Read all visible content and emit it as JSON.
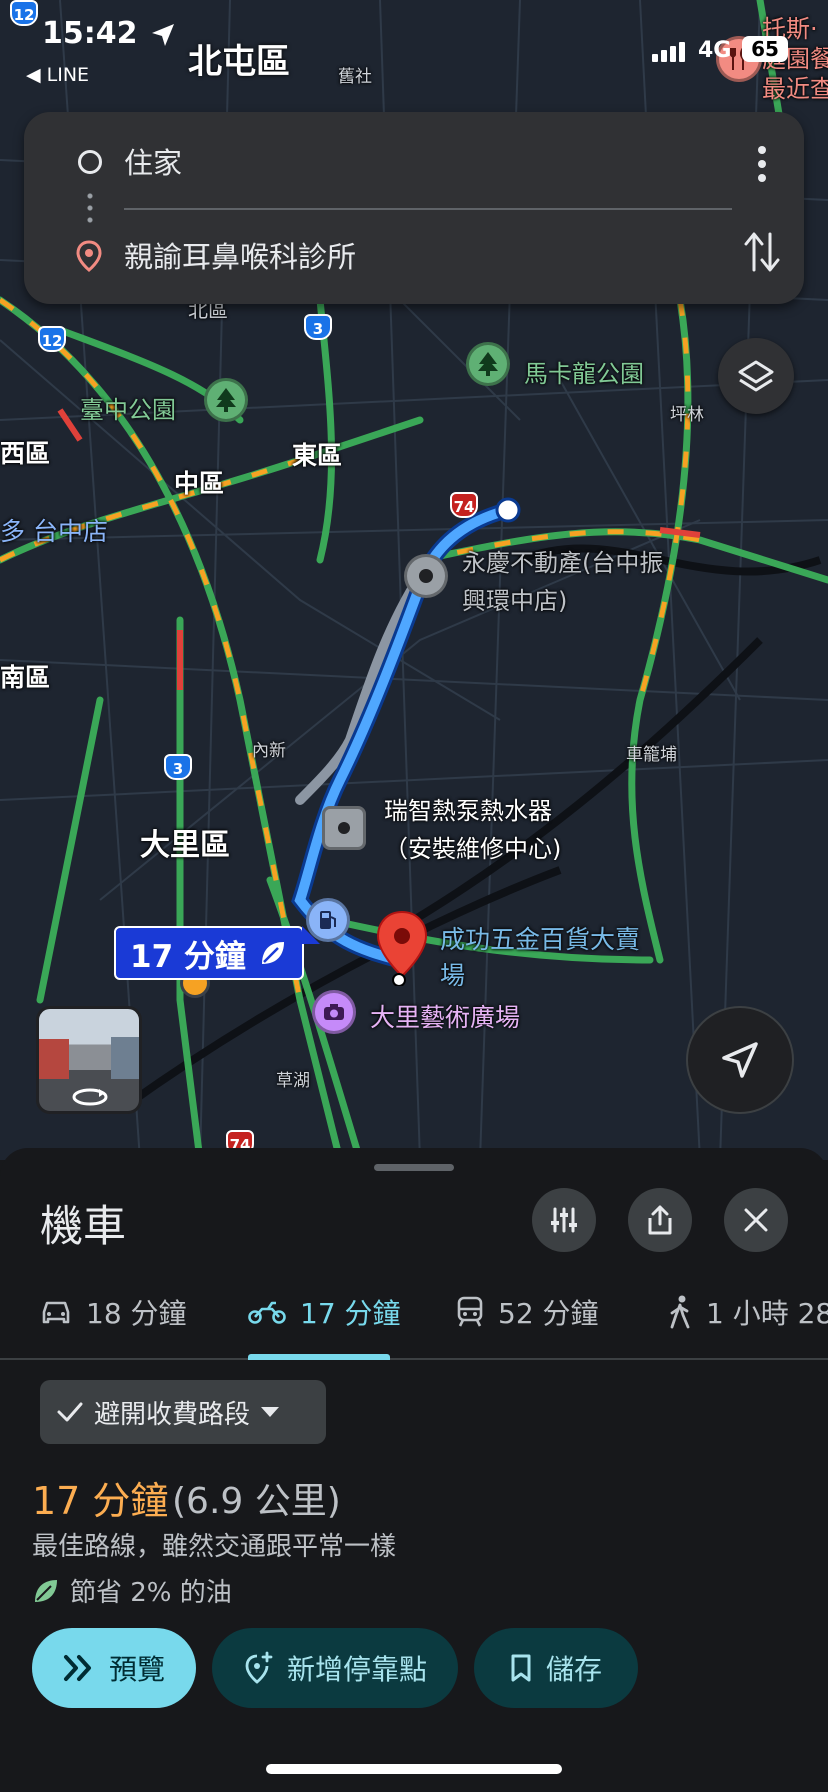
{
  "status_bar": {
    "time": "15:42",
    "back_app": "◀ LINE",
    "district": "北屯區",
    "network": "4G",
    "battery": "65"
  },
  "route_card": {
    "origin": "住家",
    "destination": "親諭耳鼻喉科診所"
  },
  "map": {
    "labels": {
      "beitun_small": "北屯",
      "jiushe": "舊社",
      "makalong_park": "馬卡龍公園",
      "pinglin": "坪林",
      "taichung_park": "臺中公園",
      "west_district": "西區",
      "central_district": "中區",
      "east_district": "東區",
      "taichung_station": "多 台中店",
      "yongqing_realestate": "永慶不動產(台中振\n興環中店)",
      "south_district": "南區",
      "neixin": "內新",
      "chelongpu": "車籠埔",
      "ruizhi_heatpump": "瑞智熱泵熱水器\n（安裝維修中心)",
      "dali_district": "大里區",
      "chenggong_hardware": "成功五金百貨大賣\n場",
      "dali_art_plaza": "大里藝術廣場",
      "caohu": "草湖",
      "top_right_poi": "托斯·\n庭園餐\n最近查",
      "beiqu_small": "北區"
    },
    "shields": {
      "s12a": "12",
      "s12b": "12",
      "s3a": "3",
      "s3b": "3",
      "s74a": "74",
      "s74b": "74"
    },
    "eta_bubble": "17 分鐘",
    "colors": {
      "route_blue": "#4fa7ff",
      "traffic_green": "#3aa757",
      "traffic_orange": "#f6a223",
      "traffic_red": "#e0413a"
    }
  },
  "sheet": {
    "title": "機車",
    "tabs": [
      {
        "icon": "car-icon",
        "label": "18 分鐘"
      },
      {
        "icon": "motorcycle-icon",
        "label": "17 分鐘"
      },
      {
        "icon": "transit-icon",
        "label": "52 分鐘"
      },
      {
        "icon": "walk-icon",
        "label": "1 小時 28"
      }
    ],
    "avoid_chip": "避開收費路段",
    "route_duration": "17 分鐘",
    "route_distance": "(6.9 公里)",
    "route_description": "最佳路線，雖然交通跟平常一樣",
    "fuel_saving": "節省 2% 的油",
    "buttons": {
      "preview": "預覽",
      "add_stop": "新增停靠點",
      "save": "儲存"
    }
  }
}
